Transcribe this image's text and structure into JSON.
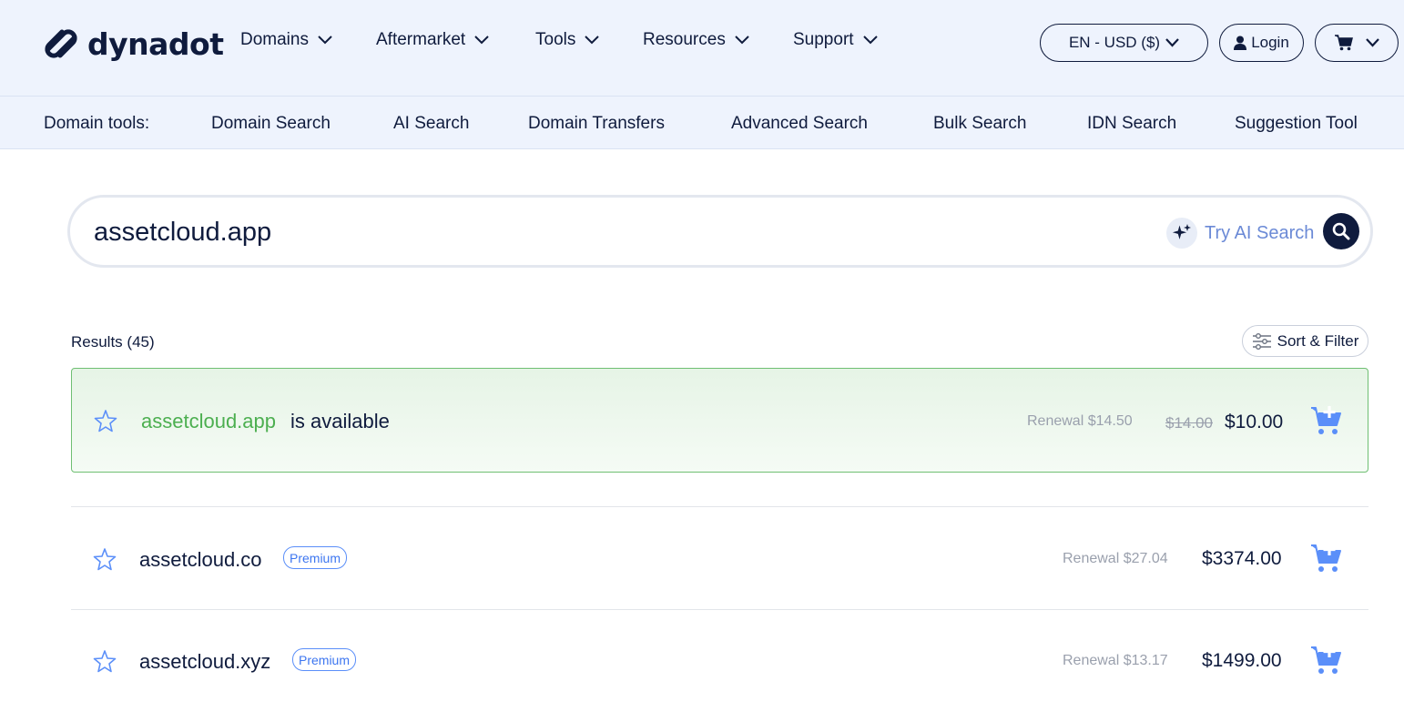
{
  "brand": {
    "name": "dynadot"
  },
  "nav": {
    "items": [
      {
        "label": "Domains"
      },
      {
        "label": "Aftermarket"
      },
      {
        "label": "Tools"
      },
      {
        "label": "Resources"
      },
      {
        "label": "Support"
      }
    ],
    "currency_label": "EN - USD ($)",
    "login_label": "Login"
  },
  "subnav": {
    "title": "Domain tools:",
    "items": [
      {
        "label": "Domain Search"
      },
      {
        "label": "AI Search"
      },
      {
        "label": "Domain Transfers"
      },
      {
        "label": "Advanced Search"
      },
      {
        "label": "Bulk Search"
      },
      {
        "label": "IDN Search"
      },
      {
        "label": "Suggestion Tool"
      }
    ]
  },
  "search": {
    "value": "assetcloud.app",
    "ai_label": "Try AI Search"
  },
  "results": {
    "count_label": "Results (45)",
    "sort_label": "Sort & Filter",
    "available": {
      "domain": "assetcloud.app",
      "status": "is available",
      "renewal": "Renewal $14.50",
      "old_price": "$14.00",
      "price": "$10.00"
    },
    "rows": [
      {
        "domain": "assetcloud.co",
        "badge": "Premium",
        "renewal": "Renewal $27.04",
        "price": "$3374.00"
      },
      {
        "domain": "assetcloud.xyz",
        "badge": "Premium",
        "renewal": "Renewal $13.17",
        "price": "$1499.00"
      }
    ]
  },
  "colors": {
    "navy": "#0f1b3d",
    "nav_bg": "#eef3fd",
    "available_green": "#4caf50",
    "accent_blue": "#3d76f0"
  }
}
